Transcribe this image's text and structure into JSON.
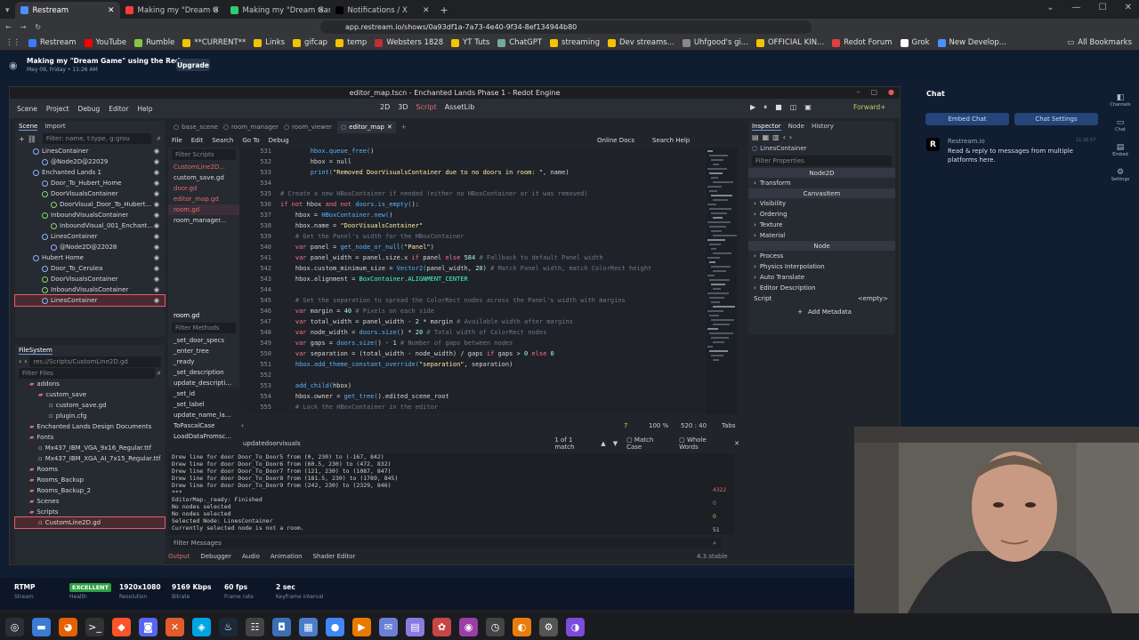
{
  "browser": {
    "tabs": [
      {
        "label": "Restream",
        "active": true,
        "color": "#4a90ff"
      },
      {
        "label": "Making my \"Dream G",
        "active": false,
        "color": "#ff3b3b"
      },
      {
        "label": "Making my \"Dream Gam",
        "active": false,
        "color": "#2ecc71"
      },
      {
        "label": "Notifications / X",
        "active": false,
        "color": "#000000"
      }
    ],
    "url": "app.restream.io/shows/0a93df1a-7a73-4e40-9f34-8ef134944b80",
    "bookmarks": [
      "Restream",
      "YouTube",
      "Rumble",
      "**CURRENT**",
      "Links",
      "gifcap",
      "temp",
      "Websters 1828",
      "YT Tuts",
      "ChatGPT",
      "streaming",
      "Dev streams...",
      "Uhfgood's gi...",
      "OFFICIAL KIN...",
      "Redot Forum",
      "Grok",
      "New Develop..."
    ],
    "all_bookmarks": "All Bookmarks"
  },
  "restream": {
    "show_title": "Making my \"Dream Game\" using the Redo...",
    "show_date": "May 09, Friday • 11:26 AM",
    "upgrade_label": "Upgrade",
    "chat": {
      "title": "Chat",
      "embed_label": "Embed Chat",
      "settings_label": "Chat Settings",
      "sender": "Restream.io",
      "time": "11:36:57",
      "message": "Read & reply to messages from multiple platforms here."
    },
    "side_nav": [
      "Channels",
      "Chat",
      "Embed",
      "Settings"
    ],
    "stats": [
      {
        "value": "RTMP",
        "label": "Stream"
      },
      {
        "value": "EXCELLENT",
        "label": "Health"
      },
      {
        "value": "1920x1080",
        "label": "Resolution"
      },
      {
        "value": "9169 Kbps",
        "label": "Bitrate"
      },
      {
        "value": "60 fps",
        "label": "Frame rate"
      },
      {
        "value": "2 sec",
        "label": "Keyframe interval"
      }
    ]
  },
  "godot": {
    "window_title": "editor_map.tscn - Enchanted Lands Phase 1 - Redot Engine",
    "menu": [
      "Scene",
      "Project",
      "Debug",
      "Editor",
      "Help"
    ],
    "modes": [
      "2D",
      "3D",
      "Script",
      "AssetLib"
    ],
    "run_label": "Forward+",
    "scene_dock": {
      "tabs": [
        "Scene",
        "Import"
      ],
      "filter_placeholder": "Filter: name, t:type, g:grou",
      "items": [
        {
          "label": "LinesContainer",
          "indent": 20,
          "color": "#8fb3ff"
        },
        {
          "label": "@Node2D@22029",
          "indent": 30,
          "color": "#8fb3ff"
        },
        {
          "label": "Enchanted Lands 1",
          "indent": 20,
          "color": "#8fb3ff"
        },
        {
          "label": "Door_To_Hubert_Home",
          "indent": 30,
          "color": "#8fb3ff"
        },
        {
          "label": "DoorVisualsContainer",
          "indent": 30,
          "color": "#8ad86a"
        },
        {
          "label": "DoorVisual_Door_To_Hubert...",
          "indent": 40,
          "color": "#8ad86a"
        },
        {
          "label": "InboundVisualsContainer",
          "indent": 30,
          "color": "#8ad86a"
        },
        {
          "label": "InboundVisual_001_Enchant...",
          "indent": 40,
          "color": "#8ad86a"
        },
        {
          "label": "LinesContainer",
          "indent": 30,
          "color": "#8fb3ff"
        },
        {
          "label": "@Node2D@22028",
          "indent": 40,
          "color": "#8fb3ff"
        },
        {
          "label": "Hubert Home",
          "indent": 20,
          "color": "#8fb3ff"
        },
        {
          "label": "Door_To_Cerulea",
          "indent": 30,
          "color": "#8fb3ff"
        },
        {
          "label": "DoorVisualsContainer",
          "indent": 30,
          "color": "#8ad86a"
        },
        {
          "label": "InboundVisualsContainer",
          "indent": 30,
          "color": "#8ad86a"
        },
        {
          "label": "LinesContainer",
          "indent": 30,
          "color": "#8fb3ff",
          "selected": true
        }
      ]
    },
    "filesystem": {
      "title": "FileSystem",
      "path": "res://Scripts/CustomLine2D.gd",
      "filter": "Filter Files",
      "items": [
        {
          "label": "addons",
          "indent": 16
        },
        {
          "label": "custom_save",
          "indent": 26
        },
        {
          "label": "custom_save.gd",
          "indent": 38
        },
        {
          "label": "plugin.cfg",
          "indent": 38
        },
        {
          "label": "Enchanted Lands Design Documents",
          "indent": 16
        },
        {
          "label": "Fonts",
          "indent": 16
        },
        {
          "label": "Mx437_IBM_VGA_9x16_Regular.ttf",
          "indent": 26
        },
        {
          "label": "Mx437_IBM_XGA_AI_7x15_Regular.ttf",
          "indent": 26
        },
        {
          "label": "Rooms",
          "indent": 16
        },
        {
          "label": "Rooms_Backup",
          "indent": 16
        },
        {
          "label": "Rooms_Backup_2",
          "indent": 16
        },
        {
          "label": "Scenes",
          "indent": 16
        },
        {
          "label": "Scripts",
          "indent": 16
        },
        {
          "label": "CustomLine2D.gd",
          "indent": 26,
          "selected": true
        }
      ]
    },
    "editor_tabs": [
      "base_scene",
      "room_manager",
      "room_viewer",
      "editor_map"
    ],
    "editor_tools": [
      "File",
      "Edit",
      "Search",
      "Go To",
      "Debug"
    ],
    "online_docs": "Online Docs",
    "search_help": "Search Help",
    "scripts_filter": "Filter Scripts",
    "scripts": [
      {
        "label": "CustomLine2D...",
        "red": true
      },
      {
        "label": "custom_save.gd",
        "red": false
      },
      {
        "label": "door.gd",
        "red": true
      },
      {
        "label": "editor_map.gd",
        "red": true
      },
      {
        "label": "room.gd",
        "red": true,
        "selected": true
      },
      {
        "label": "room_manager...",
        "red": false
      }
    ],
    "current_script": "room.gd",
    "methods_filter": "Filter Methods",
    "methods": [
      "_set_door_specs",
      "_enter_tree",
      "_ready",
      "_set_description",
      "update_descripti...",
      "_set_id",
      "_set_label",
      "update_name_la...",
      "ToPascalCase",
      "LoadDataFromsc..."
    ],
    "code": [
      {
        "n": "531",
        "t": "        hbox.queue_free()"
      },
      {
        "n": "532",
        "t": "        hbox = null"
      },
      {
        "n": "533",
        "t": "        print(\"Removed DoorVisualsContainer due to no doors in room: \", name)"
      },
      {
        "n": "534",
        "t": ""
      },
      {
        "n": "535",
        "t": "# Create a new HBoxContainer if needed (either no HBoxContainer or it was removed)"
      },
      {
        "n": "536",
        "t": "if not hbox and not doors.is_empty():"
      },
      {
        "n": "537",
        "t": "    hbox = HBoxContainer.new()"
      },
      {
        "n": "538",
        "t": "    hbox.name = \"DoorVisualsContainer\""
      },
      {
        "n": "539",
        "t": "    # Get the Panel's width for the HBoxContainer"
      },
      {
        "n": "540",
        "t": "    var panel = get_node_or_null(\"Panel\")"
      },
      {
        "n": "541",
        "t": "    var panel_width = panel.size.x if panel else 584 # Fallback to default Panel width"
      },
      {
        "n": "542",
        "t": "    hbox.custom_minimum_size = Vector2(panel_width, 20) # Match Panel width, match ColorRect height"
      },
      {
        "n": "543",
        "t": "    hbox.alignment = BoxContainer.ALIGNMENT_CENTER"
      },
      {
        "n": "544",
        "t": ""
      },
      {
        "n": "545",
        "t": "    # Set the separation to spread the ColorRect nodes across the Panel's width with margins"
      },
      {
        "n": "546",
        "t": "    var margin = 40 # Pixels on each side"
      },
      {
        "n": "547",
        "t": "    var total_width = panel_width - 2 * margin # Available width after margins"
      },
      {
        "n": "548",
        "t": "    var node_width = doors.size() * 20 # Total width of ColorRect nodes"
      },
      {
        "n": "549",
        "t": "    var gaps = doors.size() - 1 # Number of gaps between nodes"
      },
      {
        "n": "550",
        "t": "    var separation = (total_width - node_width) / gaps if gaps > 0 else 0"
      },
      {
        "n": "551",
        "t": "    hbox.add_theme_constant_override(\"separation\", separation)"
      },
      {
        "n": "552",
        "t": ""
      },
      {
        "n": "553",
        "t": "    add_child(hbox)"
      },
      {
        "n": "554",
        "t": "    hbox.owner = get_tree().edited_scene_root"
      },
      {
        "n": "555",
        "t": "    # Lock the HBoxContainer in the editor"
      }
    ],
    "status": {
      "warnings": "7",
      "zoom": "100 %",
      "position": "520 :  40",
      "indent": "Tabs"
    },
    "find": {
      "query": "updatedoorvisuals",
      "matches": "1 of 1 match",
      "match_case": "Match Case",
      "whole_words": "Whole Words"
    },
    "output_lines": [
      "Drew line for door Door_To_Door5 from (0, 230) to (-167, 842)",
      "Drew line for door Door_To_Door6 from (60.5, 230) to (472, 832)",
      "Drew line for door Door_To_Door7 from (121, 230) to (1087, 847)",
      "Drew line for door Door_To_Door8 from (181.5, 230) to (1789, 845)",
      "Drew line for door Door_To_Door9 from (242, 230) to (2329, 846)",
      "***",
      "EditorMap._ready: Finished",
      "No nodes selected",
      "No nodes selected",
      "Selected Node: LinesContainer",
      "Currently selected node is not a room."
    ],
    "filter_messages": "Filter Messages",
    "bottom_tabs": [
      "Output",
      "Debugger",
      "Audio",
      "Animation",
      "Shader Editor"
    ],
    "version": "4.3.stable",
    "inspector": {
      "tabs": [
        "Inspector",
        "Node",
        "History"
      ],
      "node_name": "LinesContainer",
      "filter": "Filter Properties",
      "class1": "Node2D",
      "sections1": [
        "Transform"
      ],
      "class2": "CanvasItem",
      "sections2": [
        "Visibility",
        "Ordering",
        "Texture",
        "Material"
      ],
      "class3": "Node",
      "sections3": [
        "Process",
        "Physics Interpolation",
        "Auto Translate",
        "Editor Description"
      ],
      "script_label": "Script",
      "script_value": "<empty>",
      "add_metadata": "Add Metadata"
    },
    "output_counts": {
      "errors_icon": "4322",
      "warnings_a": "0",
      "warnings_b": "0",
      "messages": "51"
    }
  }
}
